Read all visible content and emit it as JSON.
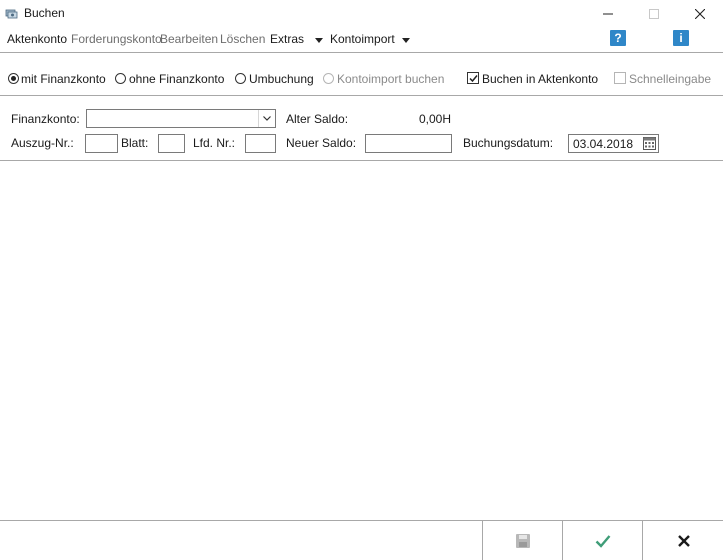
{
  "window": {
    "title": "Buchen",
    "icons": {
      "app": "money-stack-icon",
      "minimize": "minimize-icon",
      "maximize": "maximize-icon",
      "close": "close-icon"
    }
  },
  "menu": {
    "items": [
      {
        "label": "Aktenkonto",
        "enabled": true
      },
      {
        "label": "Forderungskonto",
        "enabled": false
      },
      {
        "label": "Bearbeiten",
        "enabled": false
      },
      {
        "label": "Löschen",
        "enabled": false
      },
      {
        "label": "Extras",
        "enabled": true
      },
      {
        "label": "Kontoimport",
        "enabled": true
      }
    ],
    "help_icon": "help-question-icon",
    "info_icon": "info-icon",
    "colors": {
      "icon_blue": "#2f87c8"
    }
  },
  "options": {
    "mit_finanzkonto": {
      "label": "mit Finanzkonto",
      "checked": true
    },
    "ohne_finanzkonto": {
      "label": "ohne Finanzkonto",
      "checked": false
    },
    "umbuchung": {
      "label": "Umbuchung",
      "checked": false
    },
    "kontoimport_buchen": {
      "label": "Kontoimport buchen",
      "checked": false,
      "enabled": false
    },
    "buchen_in_aktenkonto": {
      "label": "Buchen in Aktenkonto",
      "checked": true
    },
    "schnelleingabe": {
      "label": "Schnelleingabe",
      "checked": false,
      "enabled": false
    }
  },
  "form": {
    "finanzkonto_label": "Finanzkonto:",
    "finanzkonto_value": "",
    "alter_saldo_label": "Alter Saldo:",
    "alter_saldo_value": "0,00H",
    "auszug_nr_label": "Auszug-Nr.:",
    "auszug_nr_value": "",
    "blatt_label": "Blatt:",
    "blatt_value": "",
    "lfd_nr_label": "Lfd. Nr.:",
    "lfd_nr_value": "",
    "neuer_saldo_label": "Neuer Saldo:",
    "neuer_saldo_value": "",
    "buchungsdatum_label": "Buchungsdatum:",
    "buchungsdatum_value": "03.04.2018"
  },
  "footer": {
    "buttons": [
      {
        "name": "save",
        "icon": "save-disk-icon",
        "enabled": false
      },
      {
        "name": "ok",
        "icon": "checkmark-icon",
        "color": "#3f9d78"
      },
      {
        "name": "cancel",
        "icon": "close-x-icon",
        "color": "#1a1a1a"
      }
    ]
  }
}
